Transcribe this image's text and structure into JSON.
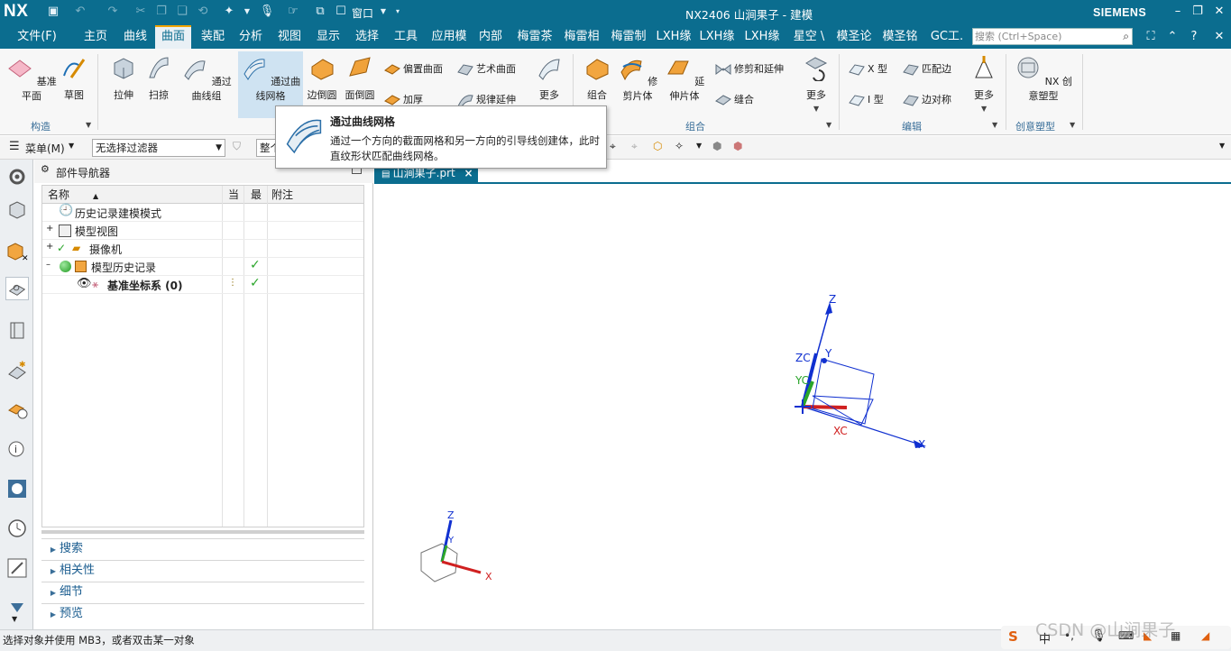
{
  "titlebar": {
    "app_logo": "NX",
    "window_menu": "窗口",
    "window_title": "NX2406 山涧果子 - 建模",
    "brand": "SIEMENS"
  },
  "menubar": {
    "tabs": [
      "文件(F)",
      "主页",
      "曲线",
      "曲面",
      "装配",
      "分析",
      "视图",
      "显示",
      "选择",
      "工具",
      "应用模",
      "内部",
      "梅雷茶",
      "梅雷相",
      "梅雷制",
      "LXH缘",
      "LXH缘",
      "LXH缘",
      "星空 \\",
      "模圣论",
      "模圣铭",
      "GC工."
    ],
    "active_tab": "曲面",
    "search_placeholder": "搜索 (Ctrl+Space)"
  },
  "ribbon": {
    "construct": {
      "datum_plane": "基准平面",
      "sketch": "草图",
      "group": "构造"
    },
    "surface_large": [
      "拉伸",
      "扫掠",
      "通过曲线组",
      "通过曲线网格",
      "边倒圆",
      "面倒圆"
    ],
    "surface_small": [
      "偏置曲面",
      "艺术曲面",
      "加厚",
      "规律延伸"
    ],
    "more": "更多",
    "combine_large": [
      "组合",
      "修剪片体",
      "延伸片体"
    ],
    "combine_small": [
      "修剪和延伸",
      "缝合"
    ],
    "combine_group": "组合",
    "edit_small": [
      "X 型",
      "匹配边",
      "I 型",
      "边对称"
    ],
    "edit_group": "编辑",
    "nx_realize": "NX 创意塑型",
    "realize_group": "创意塑型"
  },
  "selbar": {
    "menu": "菜单(M)",
    "filter": "无选择过滤器",
    "scope": "整个"
  },
  "navigator": {
    "title": "部件导航器",
    "columns": [
      "名称",
      "当",
      "最",
      "附注"
    ],
    "rows": [
      {
        "label": "历史记录建模模式"
      },
      {
        "label": "模型视图"
      },
      {
        "label": "摄像机"
      },
      {
        "label": "模型历史记录"
      },
      {
        "label": "基准坐标系 (0)"
      }
    ],
    "panes": [
      "搜索",
      "相关性",
      "细节",
      "预览"
    ]
  },
  "document_tab": "山涧果子.prt",
  "tooltip": {
    "title": "通过曲线网格",
    "description": "通过一个方向的截面网格和另一方向的引导线创建体，此时直纹形状匹配曲线网格。"
  },
  "viewport": {
    "csys_labels": {
      "z": "Z",
      "zc": "ZC",
      "y": "Y",
      "yc": "YC",
      "xc": "XC",
      "x": "X"
    },
    "triad_labels": {
      "z": "Z",
      "y": "Y",
      "x": "X"
    }
  },
  "status": "选择对象并使用 MB3，或者双击某一对象",
  "watermark": "CSDN @山涧果子",
  "colors": {
    "accent": "#0b6d8f",
    "active_tab_bar": "#f2a400",
    "csys_blue": "#1030d0",
    "axis_red": "#d02020",
    "check_green": "#2aa52a"
  }
}
